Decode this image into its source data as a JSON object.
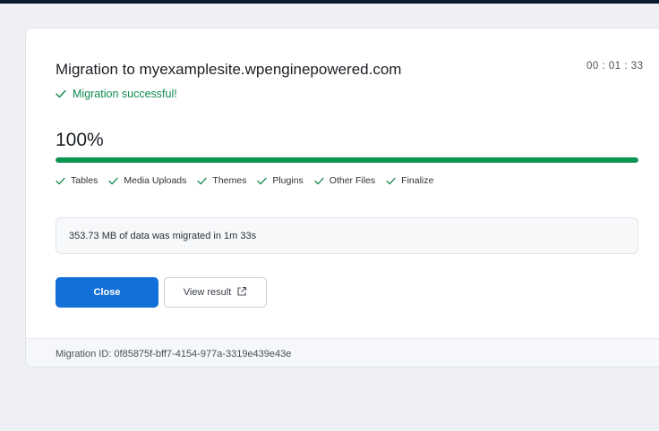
{
  "colors": {
    "accent": "#1370d8",
    "success": "#0f8a4e",
    "progress": "#0d9554"
  },
  "migration": {
    "title": "Migration to myexamplesite.wpenginepowered.com",
    "timer": "00 : 01 : 33",
    "status": "Migration successful!",
    "status_icon": "check-icon",
    "percent": "100%",
    "progress": 1.0
  },
  "steps": [
    {
      "label": "Tables",
      "icon": "check-icon"
    },
    {
      "label": "Media Uploads",
      "icon": "check-icon"
    },
    {
      "label": "Themes",
      "icon": "check-icon"
    },
    {
      "label": "Plugins",
      "icon": "check-icon"
    },
    {
      "label": "Other Files",
      "icon": "check-icon"
    },
    {
      "label": "Finalize",
      "icon": "check-icon"
    }
  ],
  "summary": "353.73 MB of data was migrated in 1m 33s",
  "buttons": {
    "close_label": "Close",
    "view_label": "View result",
    "view_icon": "external-link-icon"
  },
  "footer": {
    "migration_id": "Migration ID: 0f85875f-bff7-4154-977a-3319e439e43e"
  }
}
